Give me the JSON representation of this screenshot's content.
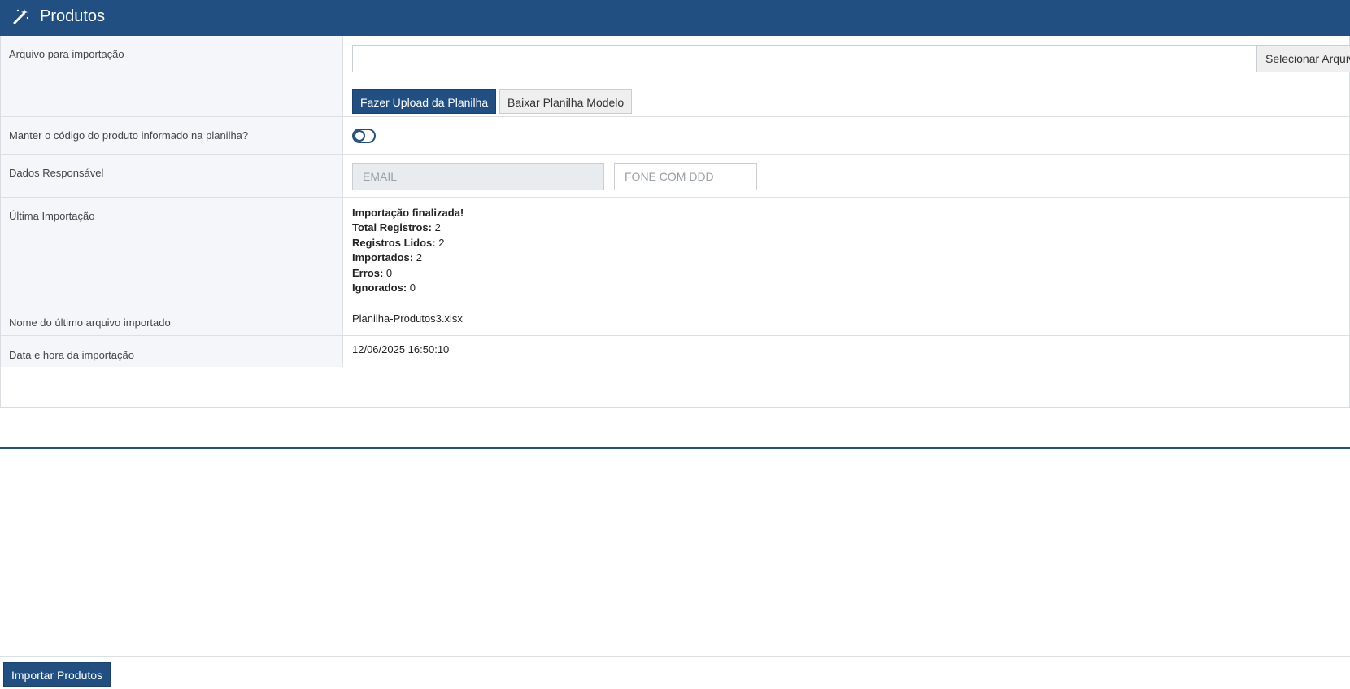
{
  "header": {
    "title": "Produtos",
    "icon": "magic-wand-icon"
  },
  "form": {
    "file_row": {
      "label": "Arquivo para importação",
      "file_input_value": "",
      "select_button": "Selecionar Arquivo",
      "upload_button": "Fazer Upload da Planilha",
      "download_button": "Baixar Planilha Modelo"
    },
    "keep_code_row": {
      "label": "Manter o código do produto informado na planilha?",
      "toggle_on": false
    },
    "responsible_row": {
      "label": "Dados Responsável",
      "email_placeholder": "EMAIL",
      "phone_placeholder": "FONE COM DDD"
    },
    "last_import_row": {
      "label": "Última Importação",
      "status": "Importação finalizada!",
      "total_label": "Total Registros:",
      "total_value": "2",
      "read_label": "Registros Lidos:",
      "read_value": "2",
      "imported_label": "Importados:",
      "imported_value": "2",
      "errors_label": "Erros:",
      "errors_value": "0",
      "ignored_label": "Ignorados:",
      "ignored_value": "0"
    },
    "last_file_row": {
      "label": "Nome do último arquivo importado",
      "value": "Planilha-Produtos3.xlsx"
    },
    "datetime_row": {
      "label": "Data e hora da importação",
      "value": "12/06/2025 16:50:10"
    }
  },
  "footer": {
    "import_button": "Importar Produtos"
  },
  "colors": {
    "primary": "#214f82",
    "label_bg": "#f4f6f9",
    "border": "#dcdfe4"
  }
}
